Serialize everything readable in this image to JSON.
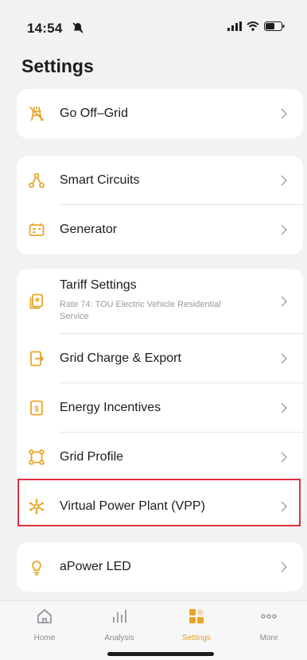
{
  "status": {
    "time": "14:54"
  },
  "title": "Settings",
  "groups": {
    "g1": {
      "items": [
        {
          "label": "Go Off–Grid"
        }
      ]
    },
    "g2": {
      "items": [
        {
          "label": "Smart Circuits"
        },
        {
          "label": "Generator"
        }
      ]
    },
    "g3": {
      "items": [
        {
          "label": "Tariff Settings",
          "sublabel": "Rate 74: TOU Electric Vehicle Residential Service"
        },
        {
          "label": "Grid Charge & Export"
        },
        {
          "label": "Energy Incentives"
        },
        {
          "label": "Grid Profile"
        },
        {
          "label": "Virtual Power Plant (VPP)"
        }
      ]
    },
    "g4": {
      "items": [
        {
          "label": "aPower LED"
        }
      ]
    }
  },
  "tabs": [
    {
      "label": "Home",
      "icon": "home-icon",
      "active": false
    },
    {
      "label": "Analysis",
      "icon": "analysis-icon",
      "active": false
    },
    {
      "label": "Settings",
      "icon": "settings-icon",
      "active": true
    },
    {
      "label": "More",
      "icon": "more-icon",
      "active": false
    }
  ],
  "colors": {
    "accent": "#e8a628",
    "highlight": "#e0303a",
    "background": "#f2f2f5"
  }
}
